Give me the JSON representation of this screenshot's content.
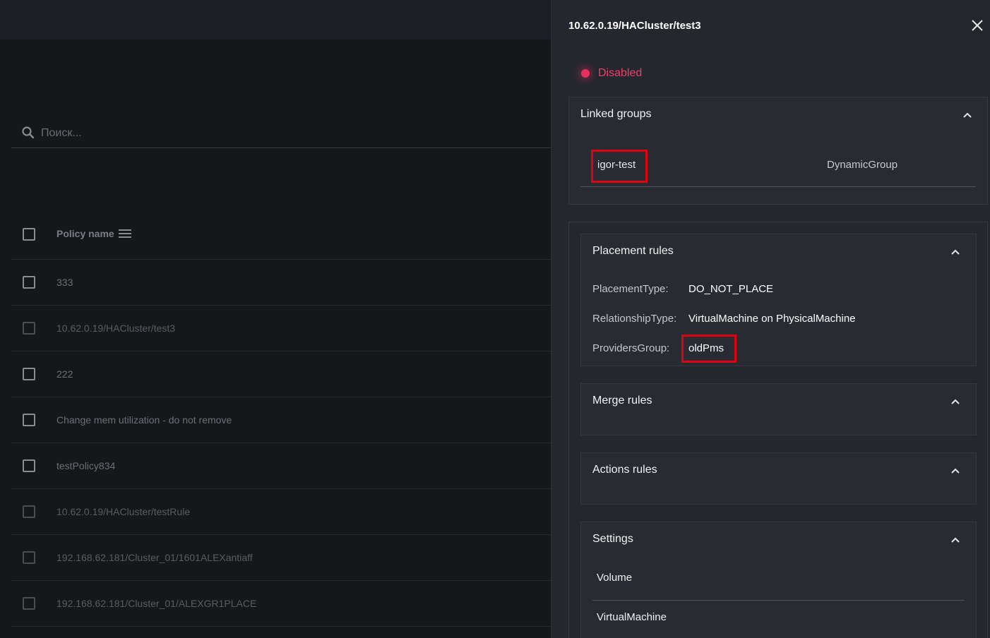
{
  "search": {
    "placeholder": "Поиск..."
  },
  "list": {
    "header_label": "Policy name",
    "rows": [
      {
        "label": "333"
      },
      {
        "label": "10.62.0.19/HACluster/test3"
      },
      {
        "label": "222"
      },
      {
        "label": "Change mem utilization - do not remove"
      },
      {
        "label": "testPolicy834"
      },
      {
        "label": "10.62.0.19/HACluster/testRule"
      },
      {
        "label": "192.168.62.181/Cluster_01/1601ALEXantiaff"
      },
      {
        "label": "192.168.62.181/Cluster_01/ALEXGR1PLACE"
      }
    ]
  },
  "panel": {
    "title": "10.62.0.19/HACluster/test3",
    "status": "Disabled",
    "status_color": "#e8305e",
    "linked_groups": {
      "title": "Linked groups",
      "name": "igor-test",
      "type": "DynamicGroup"
    },
    "placement_rules": {
      "title": "Placement rules",
      "placement_type_key": "PlacementType:",
      "placement_type_val": "DO_NOT_PLACE",
      "relationship_type_key": "RelationshipType:",
      "relationship_type_val": "VirtualMachine on PhysicalMachine",
      "providers_group_key": "ProvidersGroup:",
      "providers_group_val": "oldPms"
    },
    "merge_rules": {
      "title": "Merge rules"
    },
    "actions_rules": {
      "title": "Actions rules"
    },
    "settings": {
      "title": "Settings",
      "items": [
        "Volume",
        "VirtualMachine"
      ]
    },
    "highlight_color": "#e0000f"
  }
}
